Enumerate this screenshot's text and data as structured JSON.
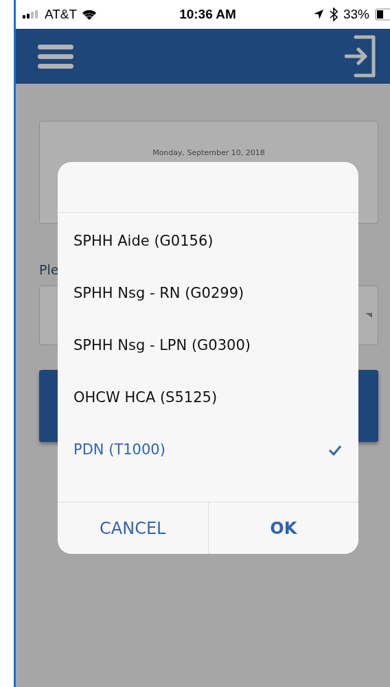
{
  "status_bar": {
    "carrier": "AT&T",
    "time": "10:36 AM",
    "battery": "33%"
  },
  "background": {
    "date": "Monday, September 10, 2018",
    "prompt": "Ple"
  },
  "picker": {
    "options": [
      {
        "label": "SPHH Aide (G0156)",
        "selected": false
      },
      {
        "label": "SPHH Nsg - RN (G0299)",
        "selected": false
      },
      {
        "label": "SPHH Nsg - LPN (G0300)",
        "selected": false
      },
      {
        "label": "OHCW HCA (S5125)",
        "selected": false
      },
      {
        "label": "PDN (T1000)",
        "selected": true
      }
    ],
    "buttons": [
      {
        "label": "CANCEL",
        "kind": "cancel"
      },
      {
        "label": "OK",
        "kind": "confirm"
      }
    ]
  }
}
